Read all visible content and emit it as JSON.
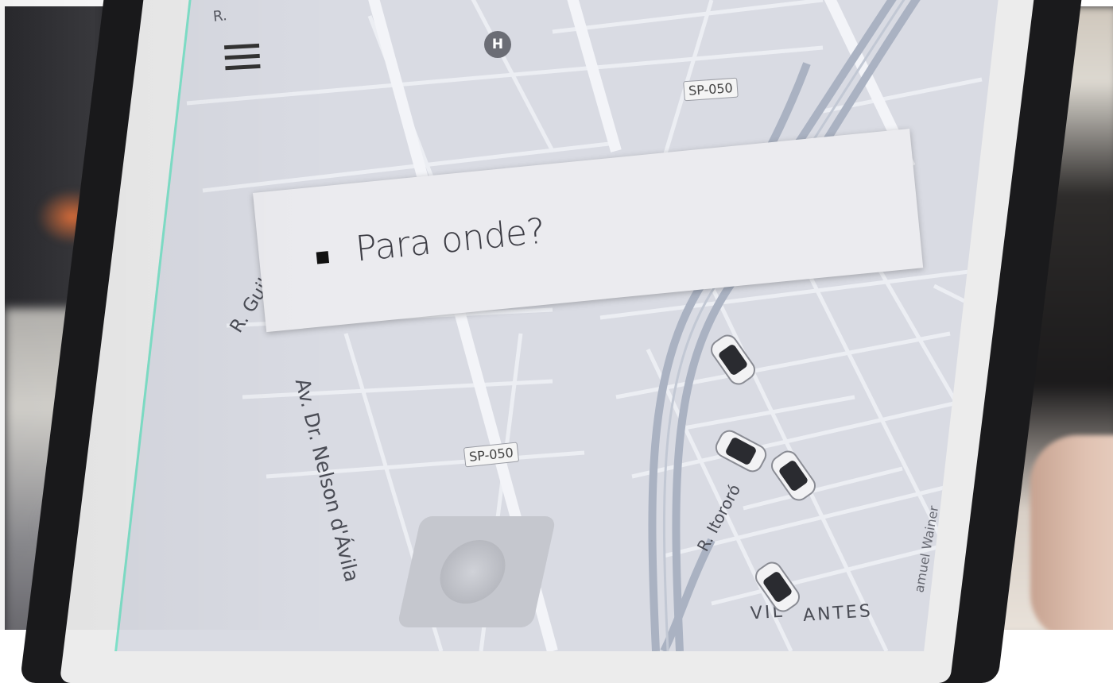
{
  "search": {
    "placeholder": "Para onde?"
  },
  "map": {
    "road_shields": [
      "SP-050",
      "SP-050"
    ],
    "streets": {
      "main_avenue": "Av. Dr. Nelson d'Ávila",
      "itororo": "R. Itororó",
      "partial_left": "R. Guil",
      "partial_right": "amuel Wainer",
      "partial_top": "R. "
    },
    "district": {
      "line1": "VIL",
      "line2": "ANTES"
    },
    "hospital_icon_letter": "H",
    "car_count": 4
  },
  "icons": {
    "menu": "hamburger-menu-icon",
    "hospital": "hospital-icon",
    "car": "car-icon",
    "locate": "locate-me-icon"
  },
  "colors": {
    "map_background": "#d9dbe3",
    "road": "#eceef3",
    "highway": "#aab2c2",
    "search_box": "#ebebef",
    "text": "#3c3c44"
  }
}
